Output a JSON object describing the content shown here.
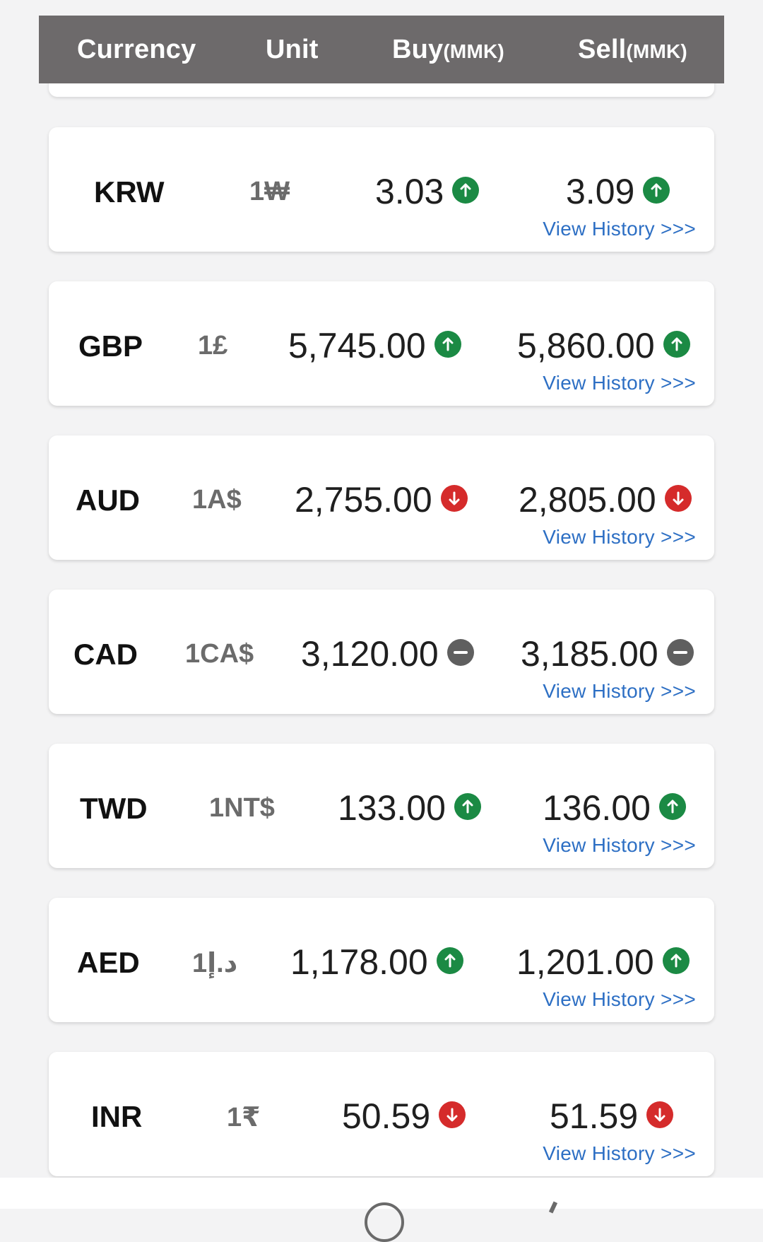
{
  "header": {
    "currency_label": "Currency",
    "unit_label": "Unit",
    "buy_label": "Buy",
    "buy_unit": "(MMK)",
    "sell_label": "Sell",
    "sell_unit": "(MMK)"
  },
  "rows": [
    {
      "code": "KRW",
      "unit": "1₩",
      "buy": "3.03",
      "buy_trend": "up",
      "sell": "3.09",
      "sell_trend": "up",
      "history": "View History >>>"
    },
    {
      "code": "GBP",
      "unit": "1£",
      "buy": "5,745.00",
      "buy_trend": "up",
      "sell": "5,860.00",
      "sell_trend": "up",
      "history": "View History >>>"
    },
    {
      "code": "AUD",
      "unit": "1A$",
      "buy": "2,755.00",
      "buy_trend": "down",
      "sell": "2,805.00",
      "sell_trend": "down",
      "history": "View History >>>"
    },
    {
      "code": "CAD",
      "unit": "1CA$",
      "buy": "3,120.00",
      "buy_trend": "same",
      "sell": "3,185.00",
      "sell_trend": "same",
      "history": "View History >>>"
    },
    {
      "code": "TWD",
      "unit": "1NT$",
      "buy": "133.00",
      "buy_trend": "up",
      "sell": "136.00",
      "sell_trend": "up",
      "history": "View History >>>"
    },
    {
      "code": "AED",
      "unit": "1د.إ",
      "buy": "1,178.00",
      "buy_trend": "up",
      "sell": "1,201.00",
      "sell_trend": "up",
      "history": "View History >>>"
    },
    {
      "code": "INR",
      "unit": "1₹",
      "buy": "50.59",
      "buy_trend": "down",
      "sell": "51.59",
      "sell_trend": "down",
      "history": "View History >>>"
    }
  ],
  "colors": {
    "header_bg": "#6d6a6b",
    "up": "#1b8a44",
    "down": "#d52b2b",
    "same": "#5f5f5f",
    "link": "#2d6fc4"
  }
}
